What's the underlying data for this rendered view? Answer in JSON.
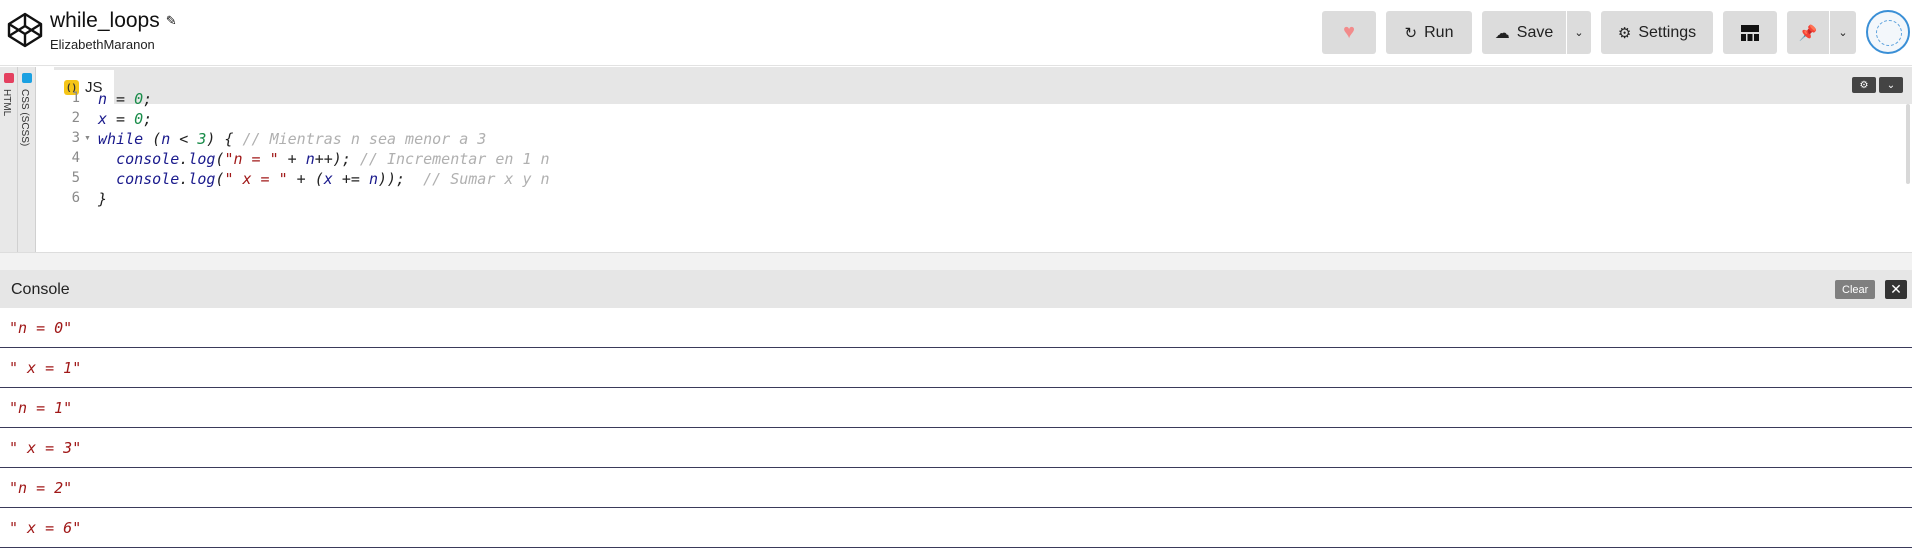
{
  "header": {
    "title": "while_loops",
    "author": "ElizabethMaranon",
    "buttons": {
      "run": "Run",
      "save": "Save",
      "settings": "Settings"
    }
  },
  "side_tabs": [
    "HTML",
    "CSS (SCSS)"
  ],
  "editor": {
    "tab_label": "JS",
    "badge": "( )",
    "line_numbers": [
      "1",
      "2",
      "3",
      "4",
      "5",
      "6"
    ]
  },
  "console": {
    "title": "Console",
    "clear_label": "Clear",
    "close_glyph": "✕",
    "rows": [
      "\"n = 0\"",
      "\" x = 1\"",
      "\"n = 1\"",
      "\" x = 3\"",
      "\"n = 2\"",
      "\" x = 6\""
    ]
  },
  "colors": {
    "heart": "#f28b8b",
    "html_dot": "#e4405f",
    "css_dot": "#1ba1e2",
    "js_badge": "#f5c518"
  },
  "icons": [
    "codepen-logo-icon",
    "pencil-icon",
    "heart-icon",
    "refresh-icon",
    "cloud-icon",
    "chevron-down-icon",
    "gear-icon",
    "layout-icon",
    "pin-icon",
    "close-icon"
  ]
}
